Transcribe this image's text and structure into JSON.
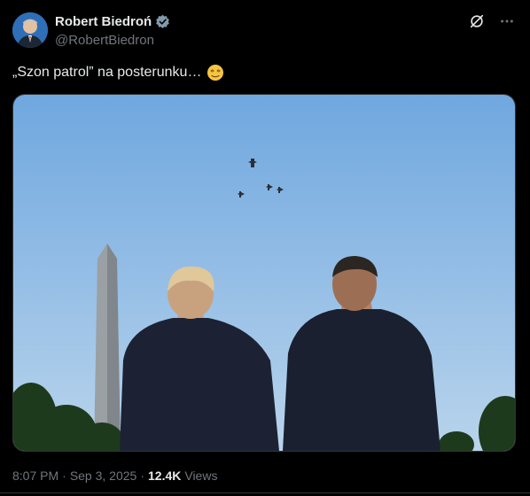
{
  "author": {
    "name": "Robert Biedroń",
    "handle": "@RobertBiedron",
    "verified_color": "#829aab"
  },
  "tweet": {
    "text": "„Szon patrol” na posterunku…",
    "emoji": "face-with-spiral-eyes-emoji"
  },
  "top_actions": {
    "grok_icon": "grok-icon",
    "more_icon": "more-icon"
  },
  "meta": {
    "time": "8:07 PM",
    "separator": "·",
    "date": "Sep 3, 2025",
    "separator2": "·",
    "views_count": "12.4K",
    "views_label": "Views"
  },
  "colors": {
    "background": "#000000",
    "text_primary": "#e7e9ea",
    "text_secondary": "#71767b",
    "border": "#2f3336",
    "sky_top": "#6fa7df",
    "sky_bottom": "#b9d4ec"
  }
}
